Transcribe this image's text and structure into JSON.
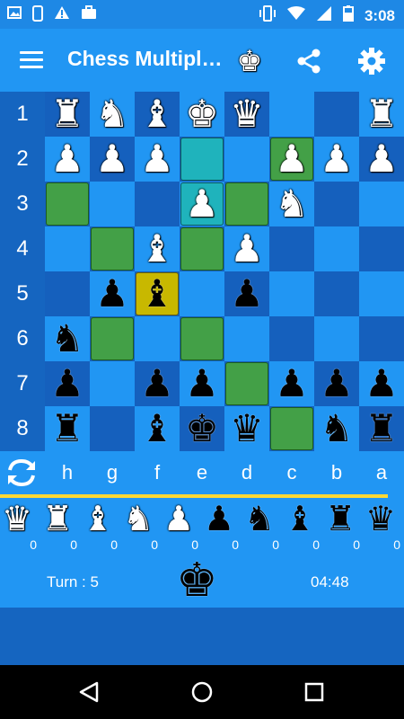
{
  "status_bar": {
    "time": "3:08",
    "left_icons": [
      "image-icon",
      "phone-icon",
      "alert-icon",
      "briefcase-icon"
    ],
    "right_icons": [
      "vibrate-icon",
      "wifi-icon",
      "signal-icon",
      "battery-icon"
    ]
  },
  "app_bar": {
    "title": "Chess Multiplayer",
    "icons": [
      "menu-icon",
      "king-icon",
      "share-icon",
      "settings-icon"
    ]
  },
  "board": {
    "ranks": [
      "1",
      "2",
      "3",
      "4",
      "5",
      "6",
      "7",
      "8"
    ],
    "files": [
      "h",
      "g",
      "f",
      "e",
      "d",
      "c",
      "b",
      "a"
    ],
    "rows": [
      [
        "wR",
        "wN",
        "wB",
        "wK",
        "wQ",
        "",
        "",
        "wR"
      ],
      [
        "wP",
        "wP",
        "wP",
        "",
        "",
        "wP",
        "wP",
        "wP"
      ],
      [
        "",
        "",
        "",
        "wP",
        "",
        "wN",
        "",
        ""
      ],
      [
        "",
        "",
        "wB",
        "",
        "wP",
        "",
        "",
        ""
      ],
      [
        "",
        "bP",
        "bB",
        "",
        "bP",
        "",
        "",
        ""
      ],
      [
        "bN",
        "",
        "",
        "",
        "",
        "",
        "",
        ""
      ],
      [
        "bP",
        "",
        "bP",
        "bP",
        "",
        "bP",
        "bP",
        "bP"
      ],
      [
        "bR",
        "",
        "bB",
        "bK",
        "bQ",
        "",
        "bN",
        "bR"
      ]
    ],
    "highlights": [
      [
        "",
        "",
        "",
        "",
        "",
        "",
        "",
        ""
      ],
      [
        "",
        "",
        "",
        "teal",
        "",
        "green",
        "",
        ""
      ],
      [
        "green",
        "",
        "",
        "teal",
        "green",
        "",
        "",
        ""
      ],
      [
        "",
        "green",
        "",
        "green",
        "",
        "",
        "",
        ""
      ],
      [
        "",
        "",
        "yellow",
        "",
        "",
        "",
        "",
        ""
      ],
      [
        "",
        "green",
        "",
        "green",
        "",
        "",
        "",
        ""
      ],
      [
        "",
        "",
        "",
        "",
        "green",
        "",
        "",
        ""
      ],
      [
        "",
        "",
        "",
        "",
        "",
        "green",
        "",
        ""
      ]
    ]
  },
  "captures": [
    {
      "piece": "wQ",
      "count": "0"
    },
    {
      "piece": "wR",
      "count": "0"
    },
    {
      "piece": "wB",
      "count": "0"
    },
    {
      "piece": "wN",
      "count": "0"
    },
    {
      "piece": "wP",
      "count": "0"
    },
    {
      "piece": "bP",
      "count": "0"
    },
    {
      "piece": "bN",
      "count": "0"
    },
    {
      "piece": "bB",
      "count": "0"
    },
    {
      "piece": "bR",
      "count": "0"
    },
    {
      "piece": "bQ",
      "count": "0"
    }
  ],
  "progress": {
    "fraction": 0.96
  },
  "info": {
    "turn": "Turn : 5",
    "turn_piece": "bK",
    "timer": "04:48"
  },
  "nav_bar": {
    "icons": [
      "back-icon",
      "home-icon",
      "recents-icon"
    ]
  },
  "colors": {
    "light_square": "#2196f3",
    "dark_square": "#1560bd",
    "move_highlight": "#43a047",
    "selected_highlight": "#1fb3bc",
    "last_move_highlight": "#c8b800",
    "progress": "#fdd835"
  }
}
